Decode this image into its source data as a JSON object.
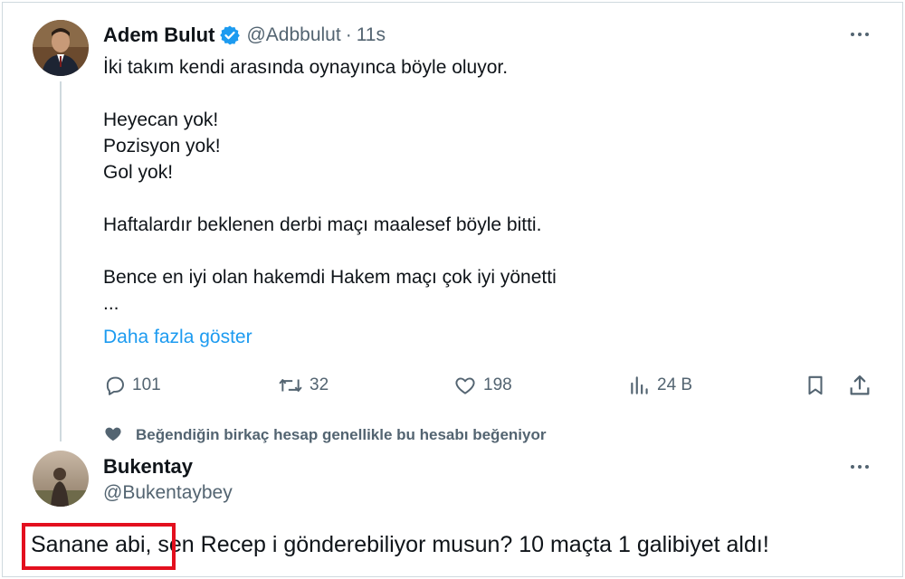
{
  "tweet1": {
    "author_name": "Adem Bulut",
    "handle": "@Adbbulut",
    "separator": "·",
    "time": "11s",
    "lines": [
      "İki takım kendi arasında oynayınca böyle oluyor.",
      "",
      "Heyecan yok!",
      "Pozisyon yok!",
      "Gol yok!",
      "",
      "Haftalardır beklenen derbi maçı maalesef böyle bitti.",
      "",
      "Bence en iyi olan hakemdi Hakem maçı çok iyi yönetti",
      "..."
    ],
    "show_more": "Daha fazla göster",
    "stats": {
      "replies": "101",
      "retweets": "32",
      "likes": "198",
      "views": "24 B"
    }
  },
  "social_context": "Beğendiğin birkaç hesap genellikle bu hesabı beğeniyor",
  "tweet2": {
    "author_name": "Bukentay",
    "handle": "@Bukentaybey",
    "text": "Sanane abi, sen Recep i gönderebiliyor musun? 10 maçta 1 galibiyet aldı!"
  },
  "colors": {
    "verified": "#1d9bf0",
    "link": "#1d9bf0",
    "muted": "#536471",
    "highlight": "#e3101e"
  },
  "icons": {
    "verified": "verified-badge-icon",
    "more": "more-icon",
    "reply": "reply-icon",
    "retweet": "retweet-icon",
    "like": "heart-icon",
    "views": "views-icon",
    "bookmark": "bookmark-icon",
    "share": "share-icon",
    "social": "heart-icon"
  }
}
